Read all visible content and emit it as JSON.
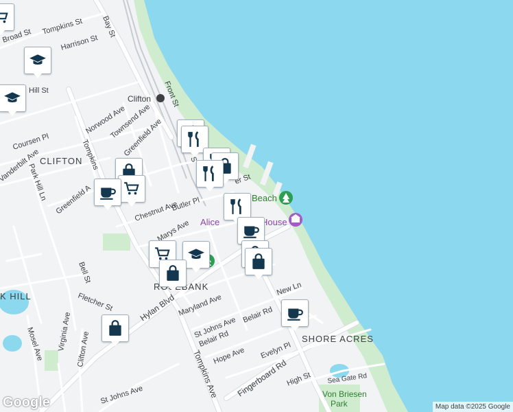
{
  "map": {
    "attribution": "Map data ©2025 Google",
    "logo": "Google",
    "colors": {
      "water": "#8cd8ee",
      "land": "#f1f3f4",
      "park": "#cfeccf",
      "marker_icon": "#12374f"
    }
  },
  "streets": {
    "broad_st": "Broad St",
    "tompkins_st": "Tompkins St",
    "harrison_st": "Harrison St",
    "bay_st": "Bay St",
    "hill_st": "Hill St",
    "front_st": "Front St",
    "clifton": "Clifton",
    "norwood_ave": "Norwood Ave",
    "townsend_ave": "Townsend Ave",
    "coursen_pl": "Coursen Pl",
    "greenfield_ave_n": "Greenfield Ave",
    "vanderbilt_ave": "Vanderbilt Ave",
    "tompkins_ave_n": "Tompkins",
    "park_hill_ln": "Park Hill Ln",
    "greenfield_ave_w": "Greenfield A",
    "chestnut_ave": "Chestnut Ave",
    "butler_pl": "Butler Pl",
    "marys_ave": "Marys Ave",
    "bell_st": "Bell St",
    "fletcher_st": "Fletcher St",
    "hylan_blvd": "Hylan Blvd",
    "maryland_ave": "Maryland Ave",
    "new_ln": "New Ln",
    "st_johns_ave": "St Johns Ave",
    "belair_rd": "Belair Rd",
    "belair_rd_w": "Belair Rd",
    "hope_ave": "Hope Ave",
    "evelyn_pl": "Evelyn Pl",
    "fingerboard_rd": "Fingerboard Rd",
    "high_st": "High St",
    "sea_gate_rd": "Sea Gate Rd",
    "mosel_ave": "Mosel Ave",
    "virginia_ave": "Virginia Ave",
    "clifton_ave": "Clifton Ave",
    "st_johns_ave_s": "St Johns Ave",
    "tompkins_ave_s": "Tompkins Ave",
    "er_st": "er St",
    "s_frag": "S"
  },
  "areas": {
    "clifton": "CLIFTON",
    "rosebank": "ROSEBANK",
    "shore_acres": "SHORE ACRES",
    "k_hill": "K HILL"
  },
  "pois": {
    "beach": "Beach",
    "alice": "Alice",
    "house": "House",
    "von_briesen_1": "Von Briesen",
    "von_briesen_2": "Park"
  },
  "markers": [
    {
      "type": "shopping-cart"
    },
    {
      "type": "graduation-cap"
    },
    {
      "type": "graduation-cap"
    },
    {
      "type": "restaurant"
    },
    {
      "type": "restaurant"
    },
    {
      "type": "restaurant"
    },
    {
      "type": "shopping-bag"
    },
    {
      "type": "shopping-bag"
    },
    {
      "type": "shopping-cart"
    },
    {
      "type": "coffee"
    },
    {
      "type": "restaurant"
    },
    {
      "type": "restaurant"
    },
    {
      "type": "coffee"
    },
    {
      "type": "shopping-bag"
    },
    {
      "type": "shopping-bag"
    },
    {
      "type": "shopping-cart"
    },
    {
      "type": "graduation-cap"
    },
    {
      "type": "shopping-bag"
    },
    {
      "type": "coffee"
    },
    {
      "type": "shopping-bag"
    }
  ]
}
